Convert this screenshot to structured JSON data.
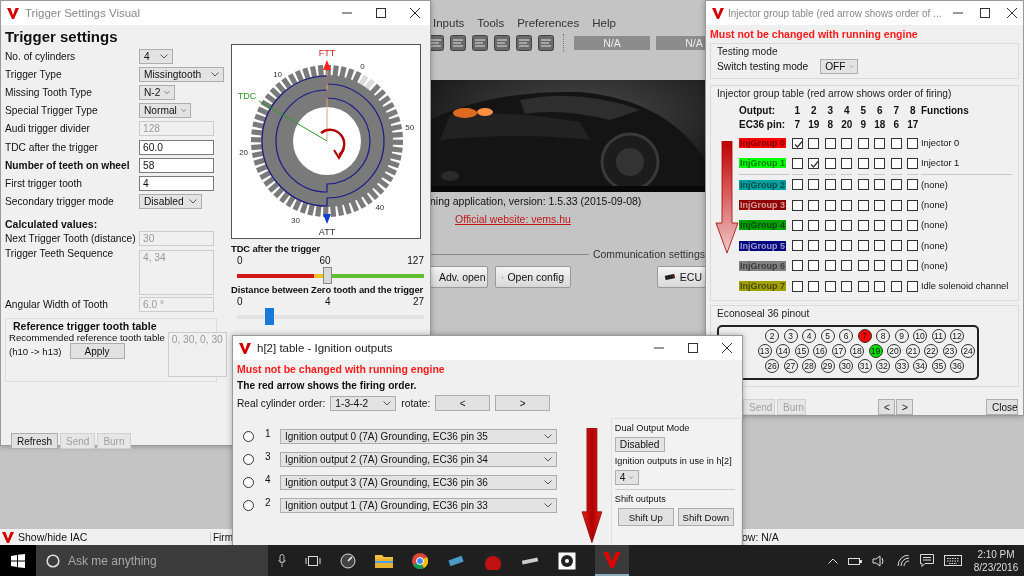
{
  "main_window": {
    "menu": [
      "Inputs",
      "Tools",
      "Preferences",
      "Help"
    ],
    "readouts": [
      "N/A",
      "N/A"
    ],
    "version_text": "ning application, version: 1.5.33 (2015-09-08)",
    "website_link": "Official website: vems.hu",
    "communication_label": "Communication settings",
    "buttons": [
      {
        "label": "Adv. open",
        "kind": "document"
      },
      {
        "label": "Open config",
        "kind": "config"
      },
      {
        "label": "ECU",
        "kind": "ecu"
      }
    ],
    "status_bar": [
      "Show/hide IAC",
      "Firm",
      "ow: N/A"
    ]
  },
  "trigger_window": {
    "title": "Trigger Settings Visual",
    "heading": "Trigger settings",
    "fields": [
      {
        "label": "No. of cylinders",
        "kind": "select",
        "value": "4",
        "bold": false
      },
      {
        "label": "Trigger Type",
        "kind": "select",
        "value": "Missingtooth",
        "bold": false
      },
      {
        "label": "Missing Tooth Type",
        "kind": "select",
        "value": "N-2",
        "bold": false
      },
      {
        "label": "Special Trigger Type",
        "kind": "select",
        "value": "Normal",
        "bold": false
      },
      {
        "label": "Audi trigger divider",
        "kind": "readonly",
        "value": "128",
        "bold": false
      },
      {
        "label": "TDC after the trigger",
        "kind": "input",
        "value": "60.0",
        "bold": false
      },
      {
        "label": "Number of teeth on wheel",
        "kind": "input",
        "value": "58",
        "bold": true
      },
      {
        "label": "First trigger tooth",
        "kind": "input",
        "value": "4",
        "bold": false
      },
      {
        "label": "Secondary trigger mode",
        "kind": "select",
        "value": "Disabled",
        "bold": false
      }
    ],
    "calculated": {
      "heading": "Calculated values:",
      "fields": [
        {
          "label": "Next Trigger Tooth (distance)",
          "kind": "readonly",
          "value": "30"
        },
        {
          "label": "Trigger Teeth Sequence",
          "kind": "textarea",
          "value": "4, 34"
        },
        {
          "label": "Angular Width of Tooth",
          "kind": "readonly",
          "value": "6.0 °"
        }
      ]
    },
    "reference": {
      "title": "Reference trigger tooth table",
      "label": "Recommended reference tooth table",
      "sublabel": "(h10 -> h13)",
      "button": "Apply",
      "value": "0, 30, 0, 30"
    },
    "wheel": {
      "top_label": "FTT",
      "bottom_label": "ATT",
      "tdc_label": "TDC",
      "ticks": [
        "0",
        "10",
        "20",
        "30",
        "40",
        "50"
      ]
    },
    "sliders": [
      {
        "title": "TDC after the trigger",
        "min": "0",
        "mid": "60",
        "max": "127",
        "level": 0.48,
        "kind": "colored"
      },
      {
        "title": "Distance between Zero tooth and the trigger",
        "min": "0",
        "mid": "4",
        "max": "27",
        "level": 0.17,
        "kind": "plain"
      }
    ],
    "buttons": [
      {
        "label": "Refresh",
        "disabled": false
      },
      {
        "label": "Send",
        "disabled": true
      },
      {
        "label": "Burn",
        "disabled": true
      }
    ]
  },
  "injector_window": {
    "title": "Injector group table (red arrow shows order of ...",
    "warning": "Must not be changed with running engine",
    "testing": {
      "title": "Testing mode",
      "label": "Switch testing mode",
      "value": "OFF"
    },
    "table": {
      "title": "Injector group table (red arrow shows order of firing)",
      "output_label": "Output:",
      "pin_label": "EC36 pin:",
      "functions_label": "Functions",
      "outputs": [
        "1",
        "2",
        "3",
        "4",
        "5",
        "6",
        "7",
        "8"
      ],
      "pins": [
        "7",
        "19",
        "8",
        "20",
        "9",
        "18",
        "6",
        "17"
      ],
      "rows": [
        {
          "name": "InjGroup 0",
          "color": "#ff0000",
          "checks": [
            true,
            false,
            false,
            false,
            false,
            false,
            false,
            false
          ],
          "function": "Injector 0"
        },
        {
          "name": "InjGroup 1",
          "color": "#00ff00",
          "checks": [
            false,
            true,
            false,
            false,
            false,
            false,
            false,
            false
          ],
          "function": "Injector 1"
        },
        {
          "name": "InjGroup 2",
          "color": "#00a0a0",
          "checks": [
            false,
            false,
            false,
            false,
            false,
            false,
            false,
            false
          ],
          "function": "(none)"
        },
        {
          "name": "InjGroup 3",
          "color": "#900000",
          "checks": [
            false,
            false,
            false,
            false,
            false,
            false,
            false,
            false
          ],
          "function": "(none)"
        },
        {
          "name": "InjGroup 4",
          "color": "#00a000",
          "checks": [
            false,
            false,
            false,
            false,
            false,
            false,
            false,
            false
          ],
          "function": "(none)"
        },
        {
          "name": "InjGroup 5",
          "color": "#000080",
          "checks": [
            false,
            false,
            false,
            false,
            false,
            false,
            false,
            false
          ],
          "function": "(none)"
        },
        {
          "name": "InjGroup 6",
          "color": "#808080",
          "checks": [
            false,
            false,
            false,
            false,
            false,
            false,
            false,
            false
          ],
          "function": "(none)"
        },
        {
          "name": "InjGroup 7",
          "color": "#a0a000",
          "checks": [
            false,
            false,
            false,
            false,
            false,
            false,
            false,
            false
          ],
          "function": "Idle solenoid channel"
        }
      ]
    },
    "pinout": {
      "title": "Econoseal 36 pinout",
      "rows": [
        [
          {
            "label": "2"
          },
          {
            "label": "3"
          },
          {
            "label": "4"
          },
          {
            "label": "5"
          },
          {
            "label": "6"
          },
          {
            "label": "7",
            "color": "#ff0000"
          },
          {
            "label": "8"
          },
          {
            "label": "9"
          },
          {
            "label": "10"
          },
          {
            "label": "11"
          },
          {
            "label": "12"
          }
        ],
        [
          {
            "label": "13"
          },
          {
            "label": "14"
          },
          {
            "label": "15"
          },
          {
            "label": "16"
          },
          {
            "label": "17"
          },
          {
            "label": "18"
          },
          {
            "label": "19",
            "color": "#00e000"
          },
          {
            "label": "20"
          },
          {
            "label": "21"
          },
          {
            "label": "22"
          },
          {
            "label": "23"
          },
          {
            "label": "24"
          }
        ],
        [
          {
            "label": "26"
          },
          {
            "label": "27"
          },
          {
            "label": "28"
          },
          {
            "label": "29"
          },
          {
            "label": "30"
          },
          {
            "label": "31"
          },
          {
            "label": "32"
          },
          {
            "label": "33"
          },
          {
            "label": "34"
          },
          {
            "label": "35"
          },
          {
            "label": "36"
          }
        ]
      ]
    },
    "buttons": [
      {
        "label": "Send",
        "disabled": true
      },
      {
        "label": "Burn",
        "disabled": true
      },
      {
        "label": "<",
        "disabled": false
      },
      {
        "label": ">",
        "disabled": false
      },
      {
        "label": "Close",
        "disabled": false
      }
    ]
  },
  "ignition_window": {
    "title": "h[2] table - Ignition outputs",
    "warning": "Must not be changed with running engine",
    "note": "The red arrow shows the firing order.",
    "order_label": "Real cylinder order:",
    "order_value": "1-3-4-2",
    "rotate_label": "rotate:",
    "rotate_buttons": [
      "<",
      ">"
    ],
    "rows": [
      {
        "selected": false,
        "cylinder": "1",
        "output": "Ignition output 0 (7A) Grounding, EC36 pin 35"
      },
      {
        "selected": false,
        "cylinder": "3",
        "output": "Ignition output 2 (7A) Grounding, EC36 pin 34"
      },
      {
        "selected": false,
        "cylinder": "4",
        "output": "Ignition output 3 (7A) Grounding, EC36 pin 36"
      },
      {
        "selected": false,
        "cylinder": "2",
        "output": "Ignition output 1 (7A) Grounding, EC36 pin 33"
      }
    ],
    "dual_label": "Dual Output Mode",
    "dual_value": "Disabled",
    "in_use_label": "Ignition outputs in use in h[2]",
    "in_use_value": "4",
    "shift_label": "Shift outputs",
    "shift_buttons": [
      "Shift Up",
      "Shift Down"
    ]
  },
  "taskbar": {
    "search_placeholder": "Ask me anything",
    "time": "2:10 PM",
    "date": "8/23/2016"
  }
}
